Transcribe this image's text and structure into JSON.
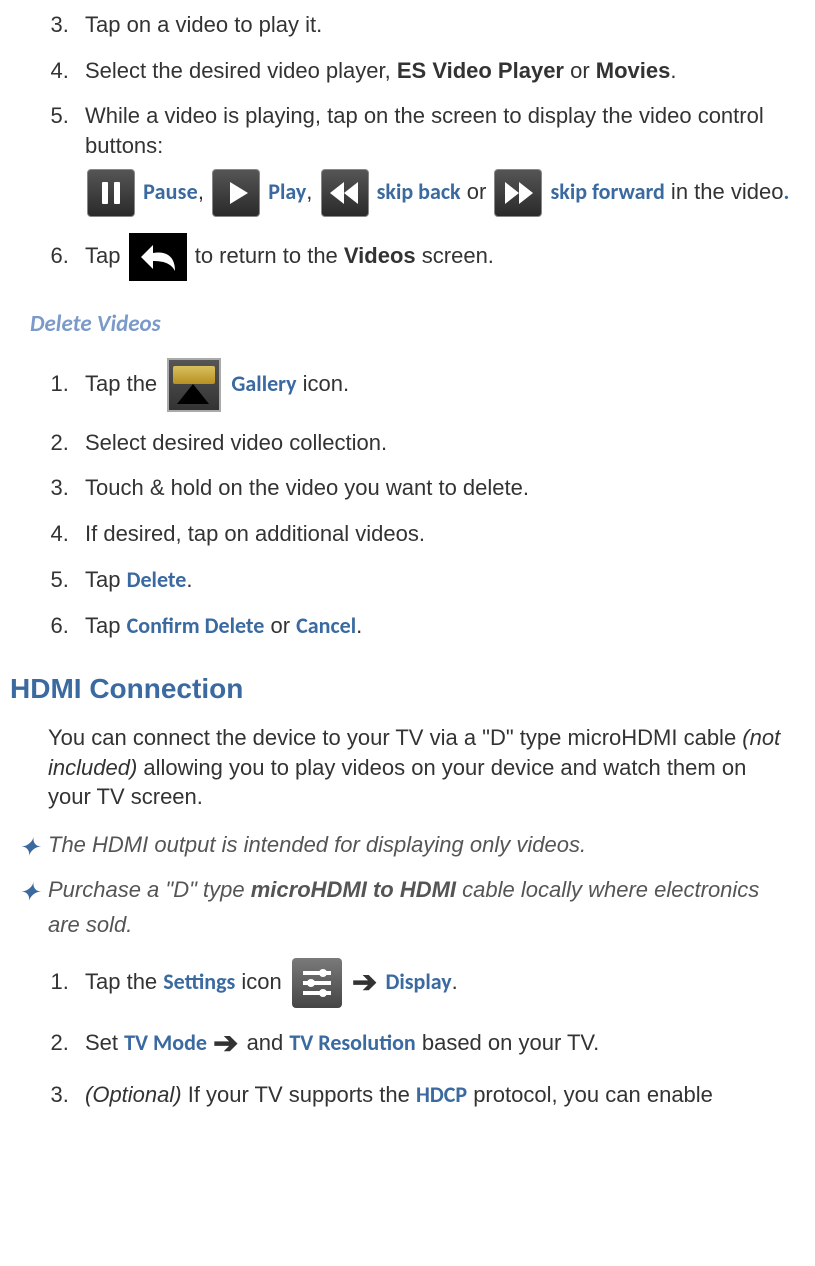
{
  "top_list": {
    "item3": "Tap on a video to play it.",
    "item4_a": "Select the desired video player, ",
    "item4_b": "ES Video Player",
    "item4_c": " or ",
    "item4_d": "Movies",
    "item4_e": ".",
    "item5_a": "While a video is playing, tap on the screen to display the video control buttons:",
    "item5_pause": "Pause",
    "item5_play": "Play",
    "item5_skipback": "skip back",
    "item5_or": " or ",
    "item5_skipfwd": "skip forward",
    "item5_tail": " in the video",
    "item5_dot": ".",
    "item6_a": "Tap ",
    "item6_b": " to return to the ",
    "item6_c": "Videos",
    "item6_d": " screen."
  },
  "delete_heading": "Delete Videos",
  "delete_list": {
    "i1_a": "Tap the ",
    "i1_b": "Gallery",
    "i1_c": " icon.",
    "i2": "Select desired video collection.",
    "i3": "Touch & hold on the video you want to delete.",
    "i4": "If desired, tap on additional videos.",
    "i5_a": "Tap ",
    "i5_b": "Delete",
    "i5_c": ".",
    "i6_a": "Tap ",
    "i6_b": "Confirm Delete",
    "i6_c": " or ",
    "i6_d": "Cancel",
    "i6_e": "."
  },
  "hdmi_heading": "HDMI Connection",
  "hdmi_intro_a": "You can connect the device to your TV via a \"D\" type microHDMI cable ",
  "hdmi_intro_b": "(not included)",
  "hdmi_intro_c": " allowing you to play videos on your device and watch them on your TV screen.",
  "note1": "The HDMI output is intended for displaying only videos.",
  "note2_a": "Purchase a \"D\" type ",
  "note2_b": "microHDMI to HDMI",
  "note2_c": " cable locally where electronics are sold.",
  "hdmi_list": {
    "i1_a": "Tap the ",
    "i1_b": "Settings",
    "i1_c": " icon ",
    "i1_d": "Display",
    "i1_e": ".",
    "i2_a": "Set ",
    "i2_b": "TV Mode",
    "i2_c": " and ",
    "i2_d": "TV Resolution",
    "i2_e": " based on your TV.",
    "i3_a": "(Optional)",
    "i3_b": " If your TV supports the ",
    "i3_c": "HDCP",
    "i3_d": " protocol, you can enable"
  },
  "comma": ", "
}
